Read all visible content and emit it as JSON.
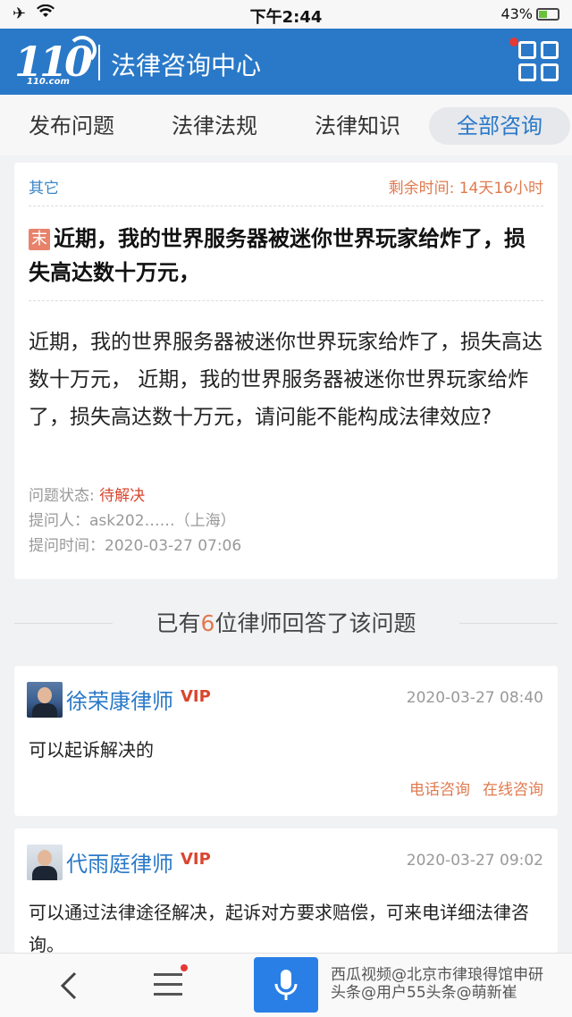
{
  "status_bar": {
    "time": "下午2:44",
    "battery": "43%",
    "icons": [
      "airplane-icon",
      "wifi-icon",
      "battery-icon"
    ]
  },
  "header": {
    "logo_number": "110",
    "logo_sub": "110.com",
    "title": "法律咨询中心",
    "menu_icon": "grid-menu-icon"
  },
  "tabs": [
    {
      "label": "发布问题",
      "active": false
    },
    {
      "label": "法律法规",
      "active": false
    },
    {
      "label": "法律知识",
      "active": false
    },
    {
      "label": "全部咨询",
      "active": true
    }
  ],
  "question": {
    "category": "其它",
    "remaining_time": "剩余时间: 14天16小时",
    "tag": "末",
    "title": "近期，我的世界服务器被迷你世界玩家给炸了，损失高达数十万元，",
    "body": "近期，我的世界服务器被迷你世界玩家给炸了，损失高达数十万元， 近期，我的世界服务器被迷你世界玩家给炸了，损失高达数十万元，请问能不能构成法律效应?",
    "status_label": "问题状态:",
    "status_value": "待解决",
    "asker": "提问人：ask202……（上海）",
    "asked_time": "提问时间：2020-03-27 07:06"
  },
  "answers_heading": {
    "prefix": "已有",
    "count": "6",
    "suffix": "位律师回答了该问题"
  },
  "answers": [
    {
      "lawyer": "徐荣康律师",
      "badge": "VIP",
      "time": "2020-03-27 08:40",
      "text": "可以起诉解决的",
      "actions": [
        "电话咨询",
        "在线咨询"
      ]
    },
    {
      "lawyer": "代雨庭律师",
      "badge": "VIP",
      "time": "2020-03-27 09:02",
      "text": "可以通过法律途径解决，起诉对方要求赔偿，可来电详细法律咨询。"
    }
  ],
  "bottom_bar": {
    "icons": [
      "back-icon",
      "menu-icon",
      "microphone-icon"
    ],
    "watermark_line1": "西瓜视频@北京市律琅得馆申研",
    "watermark_line2": "头条@用户55头条@萌新崔"
  },
  "colors": {
    "brand_blue": "#2a79c8",
    "accent_orange": "#e07a4f",
    "status_red": "#d9462f"
  }
}
